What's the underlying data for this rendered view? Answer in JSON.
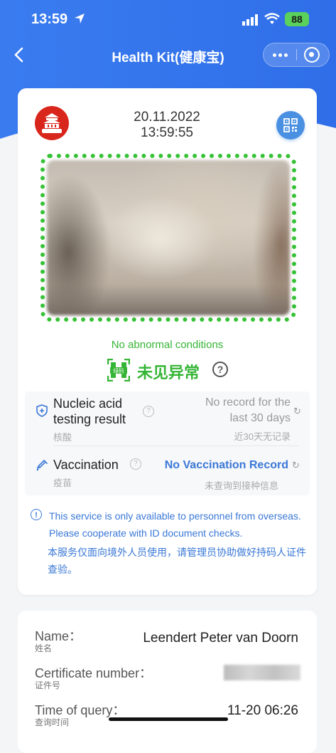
{
  "status_bar": {
    "time": "13:59",
    "battery": "88"
  },
  "nav": {
    "title": "Health Kit(健康宝)"
  },
  "card": {
    "logo_text": "北京健康宝",
    "date": "20.11.2022",
    "time": "13:59:55",
    "status_en": "No abnormal conditions",
    "green_code_label": "绿码",
    "status_cn": "未见异常",
    "help_symbol": "?",
    "nucleic": {
      "label": "Nucleic acid testing result",
      "sub": "核酸",
      "value": "No record for the last 30 days",
      "value_cn": "近30天无记录"
    },
    "vaccination": {
      "label": "Vaccination",
      "sub": "疫苗",
      "value": "No Vaccination Record",
      "value_cn": "未查询到接种信息"
    },
    "notice_en": "This service is only available to personnel from overseas. Please cooperate with ID document checks.",
    "notice_cn": "本服务仅面向境外人员使用，请管理员协助做好持码人证件查验。"
  },
  "person": {
    "name_label": "Name：",
    "name_sub": "姓名",
    "name_value": "Leendert Peter van Doorn",
    "cert_label": "Certificate number：",
    "cert_sub": "证件号",
    "query_label": "Time of query：",
    "query_sub": "查询时间",
    "query_value": "11-20 06:26"
  },
  "colors": {
    "header_blue": "#3b7ff0",
    "green": "#35b535",
    "link_blue": "#3a78d6"
  }
}
